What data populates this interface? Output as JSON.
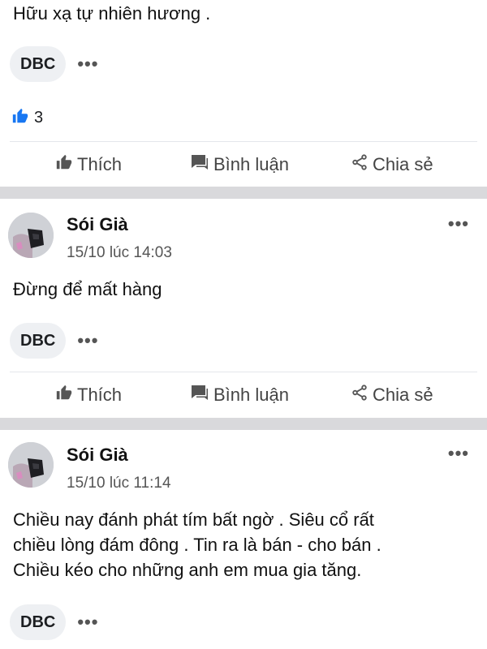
{
  "posts": [
    {
      "text": "Hữu xạ tự nhiên hương .",
      "tag": "DBC",
      "more": "•••",
      "like_count": "3",
      "actions": {
        "like": "Thích",
        "comment": "Bình luận",
        "share": "Chia sẻ"
      }
    },
    {
      "author": "Sói Già",
      "timestamp": "15/10 lúc 14:03",
      "more": "•••",
      "text": "Đừng để mất hàng",
      "tag": "DBC",
      "tag_more": "•••",
      "actions": {
        "like": "Thích",
        "comment": "Bình luận",
        "share": "Chia sẻ"
      }
    },
    {
      "author": "Sói Già",
      "timestamp": "15/10 lúc 11:14",
      "more": "•••",
      "text_lines": [
        "Chiều nay đánh phát tím bất ngờ . Siêu cổ rất",
        "chiều lòng đám đông . Tin ra là bán - cho bán .",
        "Chiều kéo cho những anh em mua gia tăng."
      ],
      "tag": "DBC",
      "tag_more": "•••"
    }
  ],
  "colors": {
    "like_blue": "#1877f2",
    "separator": "#d9d9dc",
    "tag_bg": "#eef0f3"
  }
}
